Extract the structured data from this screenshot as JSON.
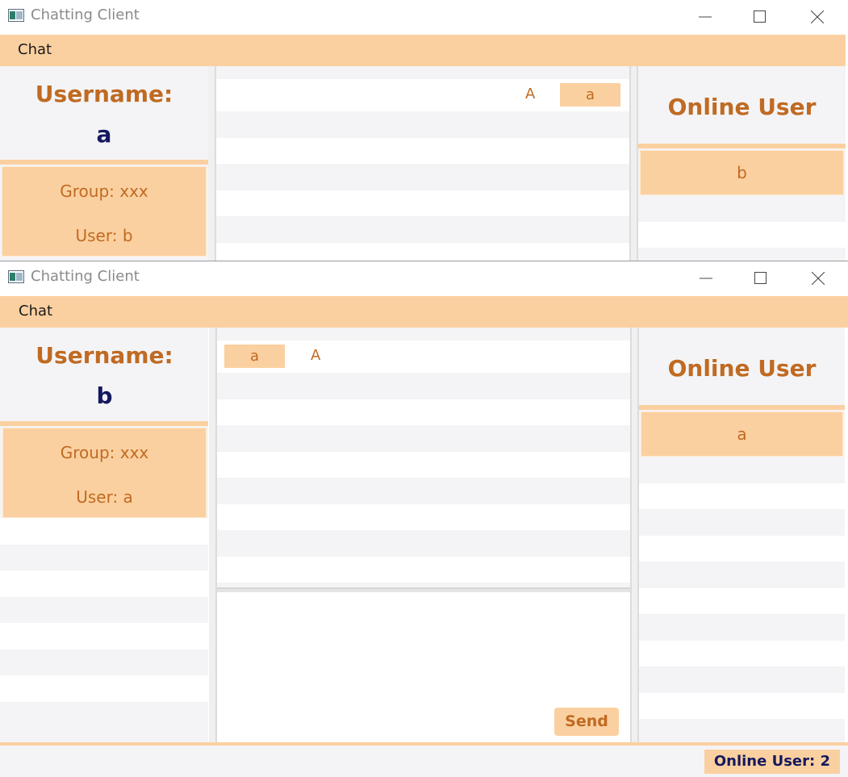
{
  "windows": [
    {
      "title": "Chatting Client",
      "menu": [
        "Chat"
      ],
      "username_label": "Username:",
      "username": "a",
      "group_card": {
        "group": "Group: xxx",
        "user": "User: b"
      },
      "online_title": "Online User",
      "online_users": [
        "b"
      ],
      "messages": [
        {
          "text": "A",
          "badge": "a",
          "side": "right"
        }
      ]
    },
    {
      "title": "Chatting Client",
      "menu": [
        "Chat"
      ],
      "username_label": "Username:",
      "username": "b",
      "group_card": {
        "group": "Group: xxx",
        "user": "User: a"
      },
      "online_title": "Online User",
      "online_users": [
        "a"
      ],
      "messages": [
        {
          "text": "A",
          "badge": "a",
          "side": "left"
        }
      ],
      "send_label": "Send",
      "status": "Online User: 2"
    }
  ],
  "colors": {
    "accent": "#fbd0a0",
    "accent_text": "#c06a22",
    "name_text": "#15195e",
    "panel_bg": "#f4f4f6"
  }
}
